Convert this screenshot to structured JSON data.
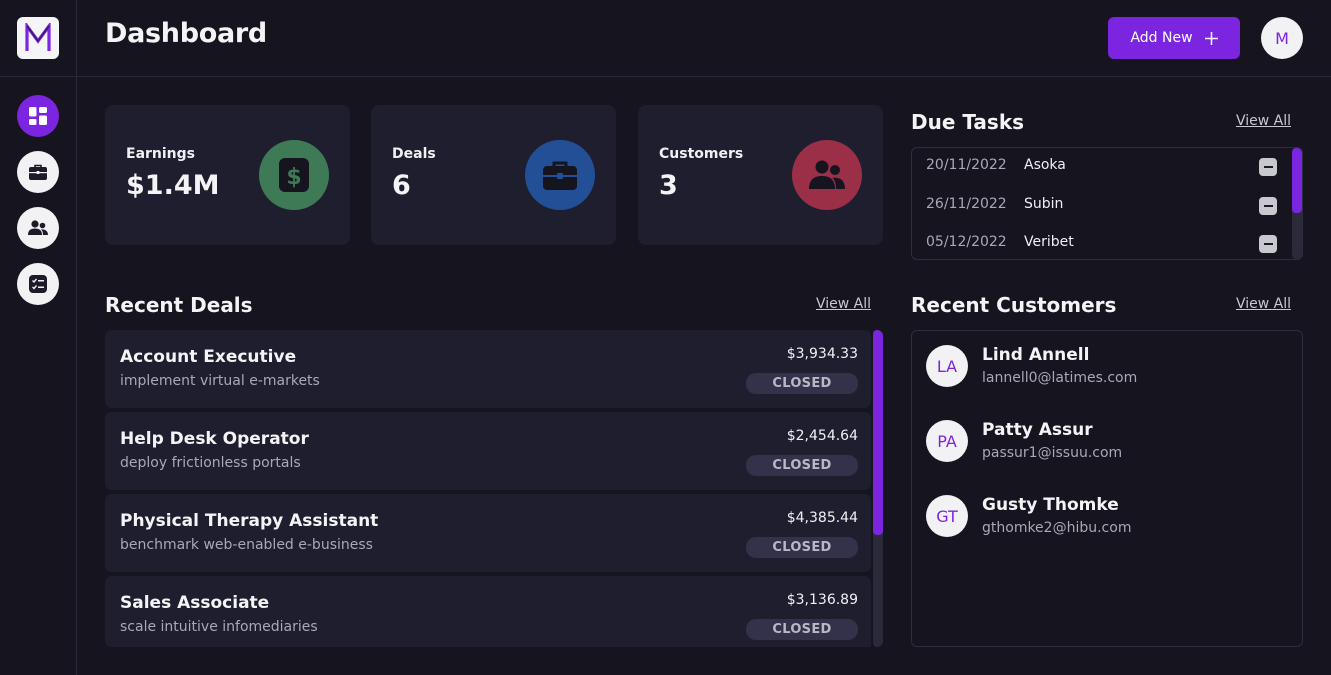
{
  "header": {
    "title": "Dashboard",
    "add_button_label": "Add New",
    "add_button_icon": "plus-icon",
    "user_avatar_initial": "M"
  },
  "sidebar": {
    "logo_letter": "M",
    "items": [
      {
        "name": "dashboard",
        "icon": "dashboard-grid-icon",
        "active": true
      },
      {
        "name": "deals",
        "icon": "briefcase-icon",
        "active": false
      },
      {
        "name": "customers",
        "icon": "users-icon",
        "active": false
      },
      {
        "name": "tasks",
        "icon": "checklist-icon",
        "active": false
      }
    ]
  },
  "stats": [
    {
      "label": "Earnings",
      "value": "$1.4M",
      "icon": "dollar-icon",
      "color": "#3f7a56"
    },
    {
      "label": "Deals",
      "value": "6",
      "icon": "briefcase-icon",
      "color": "#224f95"
    },
    {
      "label": "Customers",
      "value": "3",
      "icon": "users-icon",
      "color": "#9b2f47"
    }
  ],
  "due_tasks": {
    "title": "Due Tasks",
    "view_all": "View All",
    "items": [
      {
        "date": "20/11/2022",
        "name": "Asoka"
      },
      {
        "date": "26/11/2022",
        "name": "Subin"
      },
      {
        "date": "05/12/2022",
        "name": "Veribet"
      }
    ]
  },
  "recent_deals": {
    "title": "Recent Deals",
    "view_all": "View All",
    "items": [
      {
        "title": "Account Executive",
        "description": "implement virtual e-markets",
        "amount": "$3,934.33",
        "status": "CLOSED"
      },
      {
        "title": "Help Desk Operator",
        "description": "deploy frictionless portals",
        "amount": "$2,454.64",
        "status": "CLOSED"
      },
      {
        "title": "Physical Therapy Assistant",
        "description": "benchmark web-enabled e-business",
        "amount": "$4,385.44",
        "status": "CLOSED"
      },
      {
        "title": "Sales Associate",
        "description": "scale intuitive infomediaries",
        "amount": "$3,136.89",
        "status": "CLOSED"
      }
    ]
  },
  "recent_customers": {
    "title": "Recent Customers",
    "view_all": "View All",
    "items": [
      {
        "initials": "LA",
        "name": "Lind Annell",
        "email": "lannell0@latimes.com"
      },
      {
        "initials": "PA",
        "name": "Patty Assur",
        "email": "passur1@issuu.com"
      },
      {
        "initials": "GT",
        "name": "Gusty Thomke",
        "email": "gthomke2@hibu.com"
      }
    ]
  },
  "colors": {
    "accent": "#7b25e0",
    "background": "#15141f",
    "card": "#1f1e2e"
  }
}
